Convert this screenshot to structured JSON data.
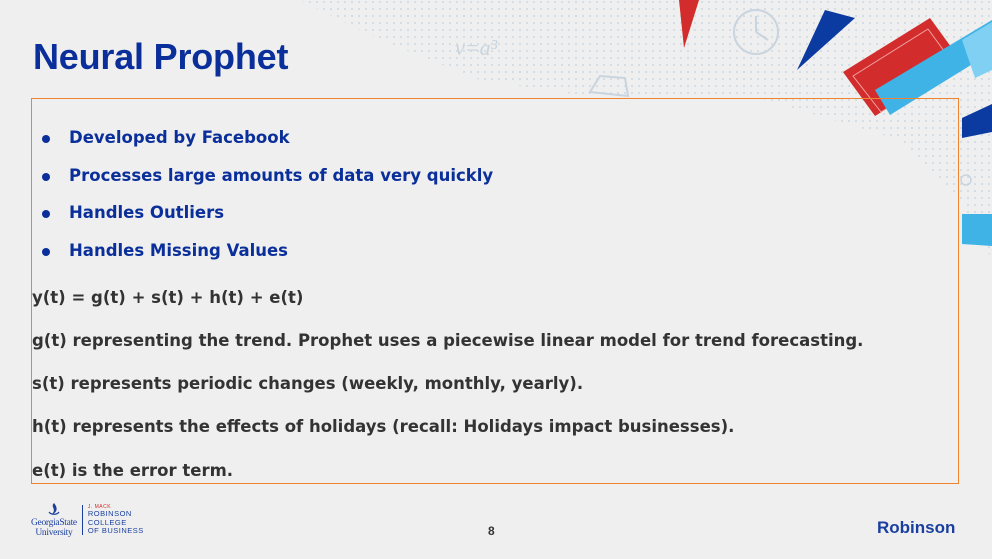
{
  "slide": {
    "title": "Neural Prophet",
    "bullets": [
      "Developed by Facebook",
      "Processes large amounts of data very quickly",
      "Handles Outliers",
      "Handles Missing Values"
    ],
    "paragraphs": [
      "y(t) = g(t) + s(t) + h(t) + e(t)",
      "g(t) representing the trend. Prophet uses a piecewise linear model for trend forecasting.",
      "s(t) represents periodic changes (weekly, monthly, yearly).",
      "h(t) represents the effects of holidays (recall: Holidays impact businesses).",
      "e(t) is the error term."
    ],
    "page_number": "8"
  },
  "footer": {
    "university_line1": "GeorgiaState",
    "university_line2": "University",
    "college_small": "J. MACK",
    "college_line1": "ROBINSON",
    "college_line2": "COLLEGE",
    "college_line3": "OF BUSINESS",
    "brand": "Robinson"
  },
  "colors": {
    "title_blue": "#0a2f9a",
    "body_text": "#333333",
    "box_border": "#f0832f",
    "accent_red": "#d22c2c",
    "accent_cyan": "#3fb3e6",
    "accent_navy": "#0b3aa0"
  }
}
